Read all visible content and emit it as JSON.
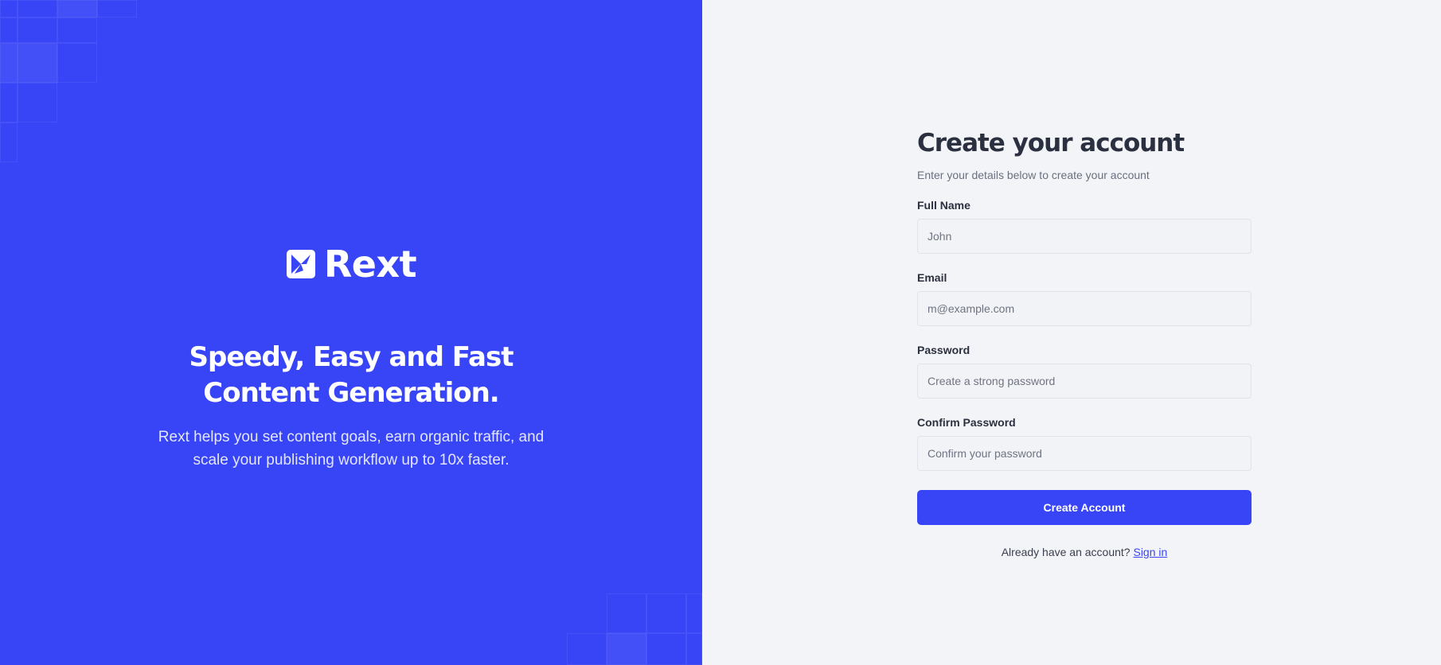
{
  "brand": {
    "name": "Rext",
    "logo_icon": "rext-logo-icon",
    "headline": "Speedy, Easy and Fast Content Generation.",
    "description": "Rext helps you set content goals, earn organic traffic, and scale your publishing workflow up to 10x faster.",
    "panel_color": "#3845f7"
  },
  "form": {
    "title": "Create your account",
    "subtitle": "Enter your details below to create your account",
    "fields": {
      "full_name": {
        "label": "Full Name",
        "value": "",
        "placeholder": "John"
      },
      "email": {
        "label": "Email",
        "value": "",
        "placeholder": "m@example.com"
      },
      "password": {
        "label": "Password",
        "value": "",
        "placeholder": "Create a strong password"
      },
      "confirm_password": {
        "label": "Confirm Password",
        "value": "",
        "placeholder": "Confirm your password"
      }
    },
    "submit_label": "Create Account",
    "signin_prompt": "Already have an account?",
    "signin_link": "Sign in",
    "accent_color": "#3845f7"
  }
}
